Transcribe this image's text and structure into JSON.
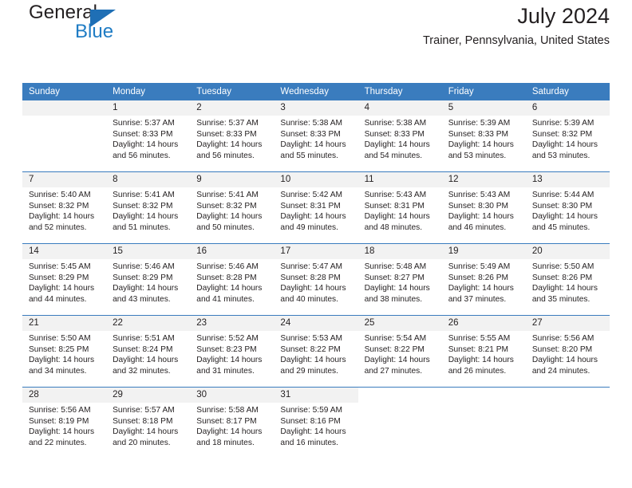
{
  "brand": {
    "name_part1": "General",
    "name_part2": "Blue",
    "accent_color": "#1f7cc4",
    "triangle_color": "#1f6fb5"
  },
  "header": {
    "title": "July 2024",
    "location": "Trainer, Pennsylvania, United States"
  },
  "calendar": {
    "header_bg": "#3a7cbe",
    "daynum_bg": "#f2f2f2",
    "weekday_names": [
      "Sunday",
      "Monday",
      "Tuesday",
      "Wednesday",
      "Thursday",
      "Friday",
      "Saturday"
    ],
    "labels": {
      "sunrise_prefix": "Sunrise:",
      "sunset_prefix": "Sunset:",
      "daylight_prefix": "Daylight:"
    },
    "weeks": [
      [
        {
          "day": "",
          "sunrise": "",
          "sunset": "",
          "daylight1": "",
          "daylight2": ""
        },
        {
          "day": "1",
          "sunrise": "Sunrise: 5:37 AM",
          "sunset": "Sunset: 8:33 PM",
          "daylight1": "Daylight: 14 hours",
          "daylight2": "and 56 minutes."
        },
        {
          "day": "2",
          "sunrise": "Sunrise: 5:37 AM",
          "sunset": "Sunset: 8:33 PM",
          "daylight1": "Daylight: 14 hours",
          "daylight2": "and 56 minutes."
        },
        {
          "day": "3",
          "sunrise": "Sunrise: 5:38 AM",
          "sunset": "Sunset: 8:33 PM",
          "daylight1": "Daylight: 14 hours",
          "daylight2": "and 55 minutes."
        },
        {
          "day": "4",
          "sunrise": "Sunrise: 5:38 AM",
          "sunset": "Sunset: 8:33 PM",
          "daylight1": "Daylight: 14 hours",
          "daylight2": "and 54 minutes."
        },
        {
          "day": "5",
          "sunrise": "Sunrise: 5:39 AM",
          "sunset": "Sunset: 8:33 PM",
          "daylight1": "Daylight: 14 hours",
          "daylight2": "and 53 minutes."
        },
        {
          "day": "6",
          "sunrise": "Sunrise: 5:39 AM",
          "sunset": "Sunset: 8:32 PM",
          "daylight1": "Daylight: 14 hours",
          "daylight2": "and 53 minutes."
        }
      ],
      [
        {
          "day": "7",
          "sunrise": "Sunrise: 5:40 AM",
          "sunset": "Sunset: 8:32 PM",
          "daylight1": "Daylight: 14 hours",
          "daylight2": "and 52 minutes."
        },
        {
          "day": "8",
          "sunrise": "Sunrise: 5:41 AM",
          "sunset": "Sunset: 8:32 PM",
          "daylight1": "Daylight: 14 hours",
          "daylight2": "and 51 minutes."
        },
        {
          "day": "9",
          "sunrise": "Sunrise: 5:41 AM",
          "sunset": "Sunset: 8:32 PM",
          "daylight1": "Daylight: 14 hours",
          "daylight2": "and 50 minutes."
        },
        {
          "day": "10",
          "sunrise": "Sunrise: 5:42 AM",
          "sunset": "Sunset: 8:31 PM",
          "daylight1": "Daylight: 14 hours",
          "daylight2": "and 49 minutes."
        },
        {
          "day": "11",
          "sunrise": "Sunrise: 5:43 AM",
          "sunset": "Sunset: 8:31 PM",
          "daylight1": "Daylight: 14 hours",
          "daylight2": "and 48 minutes."
        },
        {
          "day": "12",
          "sunrise": "Sunrise: 5:43 AM",
          "sunset": "Sunset: 8:30 PM",
          "daylight1": "Daylight: 14 hours",
          "daylight2": "and 46 minutes."
        },
        {
          "day": "13",
          "sunrise": "Sunrise: 5:44 AM",
          "sunset": "Sunset: 8:30 PM",
          "daylight1": "Daylight: 14 hours",
          "daylight2": "and 45 minutes."
        }
      ],
      [
        {
          "day": "14",
          "sunrise": "Sunrise: 5:45 AM",
          "sunset": "Sunset: 8:29 PM",
          "daylight1": "Daylight: 14 hours",
          "daylight2": "and 44 minutes."
        },
        {
          "day": "15",
          "sunrise": "Sunrise: 5:46 AM",
          "sunset": "Sunset: 8:29 PM",
          "daylight1": "Daylight: 14 hours",
          "daylight2": "and 43 minutes."
        },
        {
          "day": "16",
          "sunrise": "Sunrise: 5:46 AM",
          "sunset": "Sunset: 8:28 PM",
          "daylight1": "Daylight: 14 hours",
          "daylight2": "and 41 minutes."
        },
        {
          "day": "17",
          "sunrise": "Sunrise: 5:47 AM",
          "sunset": "Sunset: 8:28 PM",
          "daylight1": "Daylight: 14 hours",
          "daylight2": "and 40 minutes."
        },
        {
          "day": "18",
          "sunrise": "Sunrise: 5:48 AM",
          "sunset": "Sunset: 8:27 PM",
          "daylight1": "Daylight: 14 hours",
          "daylight2": "and 38 minutes."
        },
        {
          "day": "19",
          "sunrise": "Sunrise: 5:49 AM",
          "sunset": "Sunset: 8:26 PM",
          "daylight1": "Daylight: 14 hours",
          "daylight2": "and 37 minutes."
        },
        {
          "day": "20",
          "sunrise": "Sunrise: 5:50 AM",
          "sunset": "Sunset: 8:26 PM",
          "daylight1": "Daylight: 14 hours",
          "daylight2": "and 35 minutes."
        }
      ],
      [
        {
          "day": "21",
          "sunrise": "Sunrise: 5:50 AM",
          "sunset": "Sunset: 8:25 PM",
          "daylight1": "Daylight: 14 hours",
          "daylight2": "and 34 minutes."
        },
        {
          "day": "22",
          "sunrise": "Sunrise: 5:51 AM",
          "sunset": "Sunset: 8:24 PM",
          "daylight1": "Daylight: 14 hours",
          "daylight2": "and 32 minutes."
        },
        {
          "day": "23",
          "sunrise": "Sunrise: 5:52 AM",
          "sunset": "Sunset: 8:23 PM",
          "daylight1": "Daylight: 14 hours",
          "daylight2": "and 31 minutes."
        },
        {
          "day": "24",
          "sunrise": "Sunrise: 5:53 AM",
          "sunset": "Sunset: 8:22 PM",
          "daylight1": "Daylight: 14 hours",
          "daylight2": "and 29 minutes."
        },
        {
          "day": "25",
          "sunrise": "Sunrise: 5:54 AM",
          "sunset": "Sunset: 8:22 PM",
          "daylight1": "Daylight: 14 hours",
          "daylight2": "and 27 minutes."
        },
        {
          "day": "26",
          "sunrise": "Sunrise: 5:55 AM",
          "sunset": "Sunset: 8:21 PM",
          "daylight1": "Daylight: 14 hours",
          "daylight2": "and 26 minutes."
        },
        {
          "day": "27",
          "sunrise": "Sunrise: 5:56 AM",
          "sunset": "Sunset: 8:20 PM",
          "daylight1": "Daylight: 14 hours",
          "daylight2": "and 24 minutes."
        }
      ],
      [
        {
          "day": "28",
          "sunrise": "Sunrise: 5:56 AM",
          "sunset": "Sunset: 8:19 PM",
          "daylight1": "Daylight: 14 hours",
          "daylight2": "and 22 minutes."
        },
        {
          "day": "29",
          "sunrise": "Sunrise: 5:57 AM",
          "sunset": "Sunset: 8:18 PM",
          "daylight1": "Daylight: 14 hours",
          "daylight2": "and 20 minutes."
        },
        {
          "day": "30",
          "sunrise": "Sunrise: 5:58 AM",
          "sunset": "Sunset: 8:17 PM",
          "daylight1": "Daylight: 14 hours",
          "daylight2": "and 18 minutes."
        },
        {
          "day": "31",
          "sunrise": "Sunrise: 5:59 AM",
          "sunset": "Sunset: 8:16 PM",
          "daylight1": "Daylight: 14 hours",
          "daylight2": "and 16 minutes."
        },
        {
          "day": "",
          "sunrise": "",
          "sunset": "",
          "daylight1": "",
          "daylight2": ""
        },
        {
          "day": "",
          "sunrise": "",
          "sunset": "",
          "daylight1": "",
          "daylight2": ""
        },
        {
          "day": "",
          "sunrise": "",
          "sunset": "",
          "daylight1": "",
          "daylight2": ""
        }
      ]
    ]
  }
}
